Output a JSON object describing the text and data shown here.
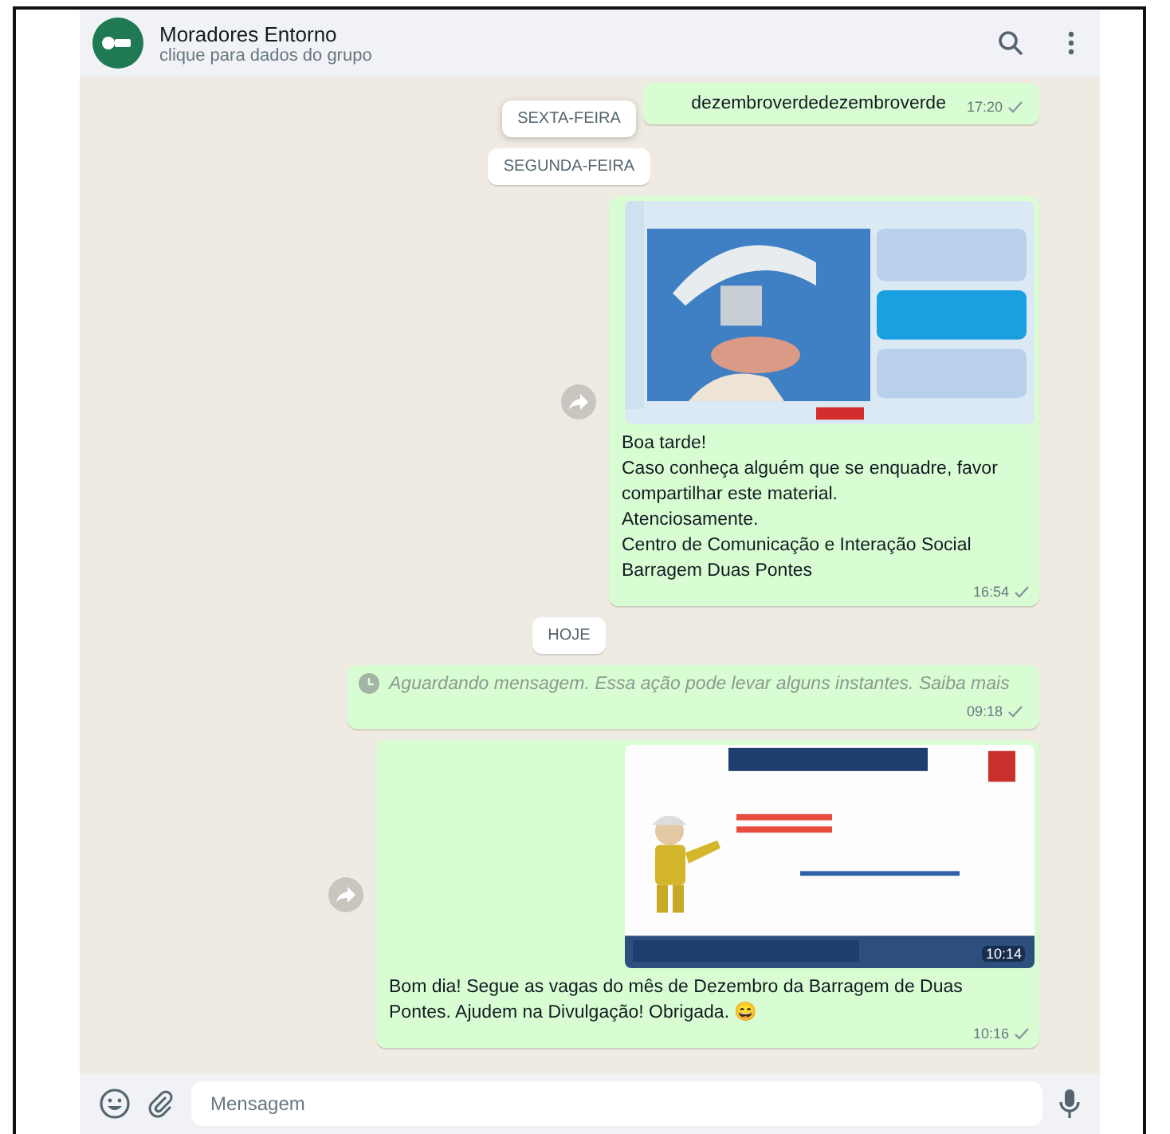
{
  "header": {
    "title": "Moradores Entorno",
    "subtitle": "clique para dados do grupo"
  },
  "messages": [
    {
      "kind": "text",
      "text": "dezembroverdedezembroverde",
      "time": "17:20"
    },
    {
      "kind": "date",
      "label": "SEXTA-FEIRA",
      "pinned": true
    },
    {
      "kind": "date",
      "label": "SEGUNDA-FEIRA",
      "pinned": false
    },
    {
      "caption": "Boa tarde!\nCaso conheça alguém que se enquadre, favor compartilhar este material.\nAtenciosamente.\nCentro de Comunicação e Interação Social\nBarragem Duas Pontes",
      "time": "16:54"
    },
    {
      "kind": "date",
      "label": "HOJE",
      "pinned": false
    },
    {
      "kind": "pending",
      "text": "Aguardando mensagem. Essa ação pode levar alguns instantes.",
      "link": "Saiba mais",
      "time": "09:18"
    },
    {
      "image_time": "10:14",
      "caption": "Bom dia! Segue as vagas do mês de Dezembro da Barragem de Duas Pontes. Ajudem na Divulgação! Obrigada. 😄",
      "time": "10:16"
    }
  ],
  "composer": {
    "placeholder": "Mensagem"
  }
}
